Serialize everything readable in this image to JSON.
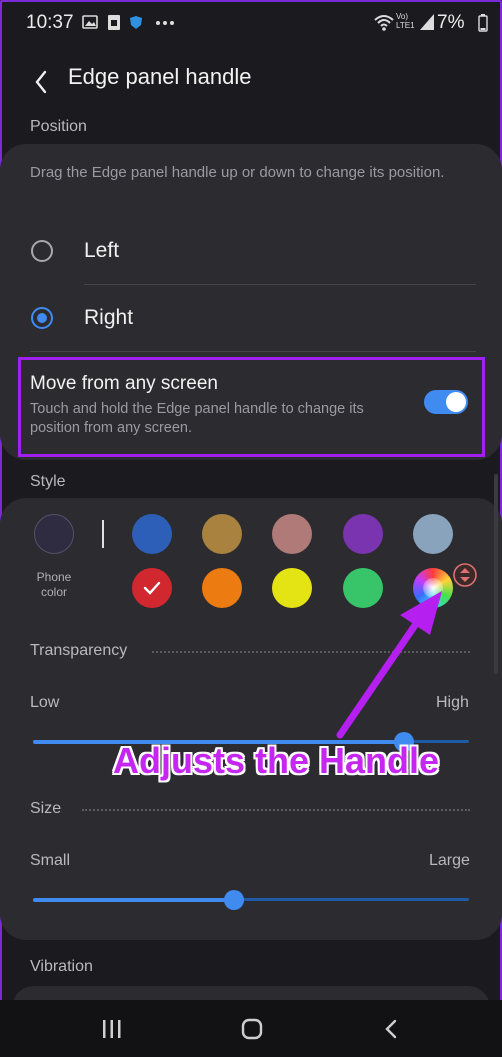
{
  "status_bar": {
    "time": "10:37",
    "battery": "7%",
    "network": "Vo) LTE1",
    "icons": [
      "image-icon",
      "sim-icon",
      "shield-icon",
      "more-icon",
      "wifi-icon",
      "signal-icon",
      "battery-icon"
    ]
  },
  "header": {
    "title": "Edge panel handle"
  },
  "position": {
    "section_label": "Position",
    "description": "Drag the Edge panel handle up or down to change its position.",
    "options": [
      {
        "label": "Left",
        "selected": false
      },
      {
        "label": "Right",
        "selected": true
      }
    ],
    "move_any_screen": {
      "title": "Move from any screen",
      "description": "Touch and hold the Edge panel handle to change its position from any screen.",
      "enabled": true
    }
  },
  "style": {
    "section_label": "Style",
    "phone_color_label": "Phone color",
    "colors": {
      "phone": "#2f2c41",
      "row1": [
        "#2d5fb8",
        "#a8823e",
        "#b07a78",
        "#7a34b0",
        "#8aa3bd"
      ],
      "row2": [
        "#d1282f",
        "#ec7c12",
        "#e4e314",
        "#38c56a",
        "spectrum"
      ],
      "selected": "#d1282f",
      "accent": "#3f8bf0",
      "highlight": "#a020f0"
    },
    "transparency": {
      "label": "Transparency",
      "low": "Low",
      "high": "High",
      "value": 0.85
    },
    "size": {
      "label": "Size",
      "small": "Small",
      "large": "Large",
      "value": 0.46
    }
  },
  "vibration": {
    "section_label": "Vibration"
  },
  "annotation": {
    "text": "Adjusts the Handle",
    "color": "#c626f2"
  },
  "navbar": {
    "icons": [
      "recents-icon",
      "home-icon",
      "back-icon"
    ]
  }
}
